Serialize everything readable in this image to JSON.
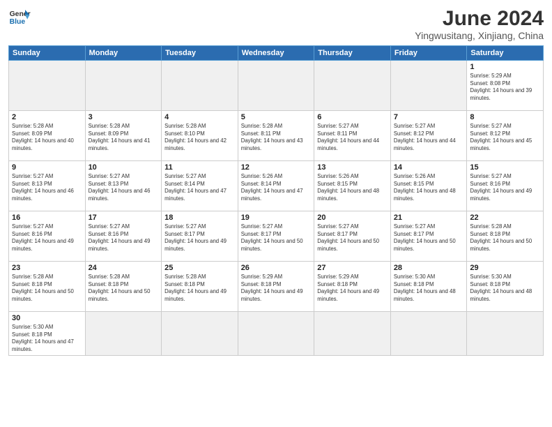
{
  "header": {
    "logo_general": "General",
    "logo_blue": "Blue",
    "month_title": "June 2024",
    "location": "Yingwusitang, Xinjiang, China"
  },
  "weekdays": [
    "Sunday",
    "Monday",
    "Tuesday",
    "Wednesday",
    "Thursday",
    "Friday",
    "Saturday"
  ],
  "days": [
    {
      "date": "",
      "empty": true
    },
    {
      "date": "",
      "empty": true
    },
    {
      "date": "",
      "empty": true
    },
    {
      "date": "",
      "empty": true
    },
    {
      "date": "",
      "empty": true
    },
    {
      "date": "",
      "empty": true
    },
    {
      "date": "1",
      "sunrise": "5:29 AM",
      "sunset": "8:08 PM",
      "daylight": "14 hours and 39 minutes."
    },
    {
      "date": "2",
      "sunrise": "5:28 AM",
      "sunset": "8:09 PM",
      "daylight": "14 hours and 40 minutes."
    },
    {
      "date": "3",
      "sunrise": "5:28 AM",
      "sunset": "8:09 PM",
      "daylight": "14 hours and 41 minutes."
    },
    {
      "date": "4",
      "sunrise": "5:28 AM",
      "sunset": "8:10 PM",
      "daylight": "14 hours and 42 minutes."
    },
    {
      "date": "5",
      "sunrise": "5:28 AM",
      "sunset": "8:11 PM",
      "daylight": "14 hours and 43 minutes."
    },
    {
      "date": "6",
      "sunrise": "5:27 AM",
      "sunset": "8:11 PM",
      "daylight": "14 hours and 44 minutes."
    },
    {
      "date": "7",
      "sunrise": "5:27 AM",
      "sunset": "8:12 PM",
      "daylight": "14 hours and 44 minutes."
    },
    {
      "date": "8",
      "sunrise": "5:27 AM",
      "sunset": "8:12 PM",
      "daylight": "14 hours and 45 minutes."
    },
    {
      "date": "9",
      "sunrise": "5:27 AM",
      "sunset": "8:13 PM",
      "daylight": "14 hours and 46 minutes."
    },
    {
      "date": "10",
      "sunrise": "5:27 AM",
      "sunset": "8:13 PM",
      "daylight": "14 hours and 46 minutes."
    },
    {
      "date": "11",
      "sunrise": "5:27 AM",
      "sunset": "8:14 PM",
      "daylight": "14 hours and 47 minutes."
    },
    {
      "date": "12",
      "sunrise": "5:26 AM",
      "sunset": "8:14 PM",
      "daylight": "14 hours and 47 minutes."
    },
    {
      "date": "13",
      "sunrise": "5:26 AM",
      "sunset": "8:15 PM",
      "daylight": "14 hours and 48 minutes."
    },
    {
      "date": "14",
      "sunrise": "5:26 AM",
      "sunset": "8:15 PM",
      "daylight": "14 hours and 48 minutes."
    },
    {
      "date": "15",
      "sunrise": "5:27 AM",
      "sunset": "8:16 PM",
      "daylight": "14 hours and 49 minutes."
    },
    {
      "date": "16",
      "sunrise": "5:27 AM",
      "sunset": "8:16 PM",
      "daylight": "14 hours and 49 minutes."
    },
    {
      "date": "17",
      "sunrise": "5:27 AM",
      "sunset": "8:16 PM",
      "daylight": "14 hours and 49 minutes."
    },
    {
      "date": "18",
      "sunrise": "5:27 AM",
      "sunset": "8:17 PM",
      "daylight": "14 hours and 49 minutes."
    },
    {
      "date": "19",
      "sunrise": "5:27 AM",
      "sunset": "8:17 PM",
      "daylight": "14 hours and 50 minutes."
    },
    {
      "date": "20",
      "sunrise": "5:27 AM",
      "sunset": "8:17 PM",
      "daylight": "14 hours and 50 minutes."
    },
    {
      "date": "21",
      "sunrise": "5:27 AM",
      "sunset": "8:17 PM",
      "daylight": "14 hours and 50 minutes."
    },
    {
      "date": "22",
      "sunrise": "5:28 AM",
      "sunset": "8:18 PM",
      "daylight": "14 hours and 50 minutes."
    },
    {
      "date": "23",
      "sunrise": "5:28 AM",
      "sunset": "8:18 PM",
      "daylight": "14 hours and 50 minutes."
    },
    {
      "date": "24",
      "sunrise": "5:28 AM",
      "sunset": "8:18 PM",
      "daylight": "14 hours and 50 minutes."
    },
    {
      "date": "25",
      "sunrise": "5:28 AM",
      "sunset": "8:18 PM",
      "daylight": "14 hours and 49 minutes."
    },
    {
      "date": "26",
      "sunrise": "5:29 AM",
      "sunset": "8:18 PM",
      "daylight": "14 hours and 49 minutes."
    },
    {
      "date": "27",
      "sunrise": "5:29 AM",
      "sunset": "8:18 PM",
      "daylight": "14 hours and 49 minutes."
    },
    {
      "date": "28",
      "sunrise": "5:30 AM",
      "sunset": "8:18 PM",
      "daylight": "14 hours and 48 minutes."
    },
    {
      "date": "29",
      "sunrise": "5:30 AM",
      "sunset": "8:18 PM",
      "daylight": "14 hours and 48 minutes."
    },
    {
      "date": "30",
      "sunrise": "5:30 AM",
      "sunset": "8:18 PM",
      "daylight": "14 hours and 47 minutes."
    }
  ]
}
